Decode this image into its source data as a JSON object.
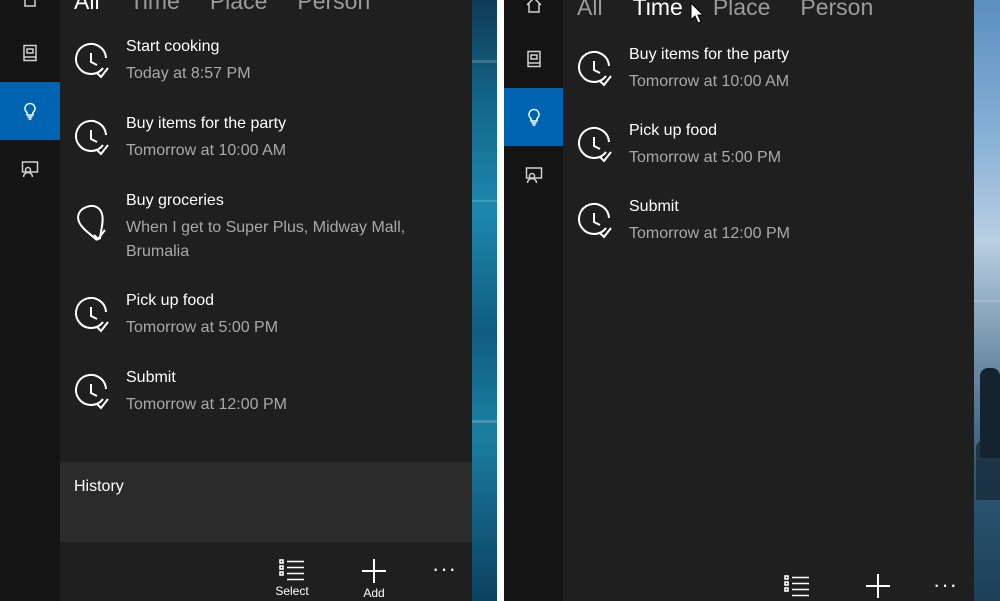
{
  "colors": {
    "accent": "#0063b1",
    "panel": "#1f1f1f",
    "rail": "#141414",
    "history": "#2b2b2b",
    "muted": "#a9a9a9"
  },
  "left_pane": {
    "tabs": [
      {
        "label": "All"
      },
      {
        "label": "Time"
      },
      {
        "label": "Place"
      },
      {
        "label": "Person"
      }
    ],
    "selected_tab": "All",
    "rail_icons": [
      "home-icon",
      "notebook-icon",
      "lightbulb-icon",
      "reminder-person-icon"
    ],
    "tasks": [
      {
        "title": "Start cooking",
        "detail": "Today at 8:57 PM",
        "icon": "clock-check-icon"
      },
      {
        "title": "Buy items for the party",
        "detail": "Tomorrow at 10:00 AM",
        "icon": "clock-check-icon"
      },
      {
        "title": "Buy groceries",
        "detail": "When I get to Super Plus, Midway Mall, Brumalia",
        "icon": "location-pin-icon"
      },
      {
        "title": "Pick up food",
        "detail": "Tomorrow at 5:00 PM",
        "icon": "clock-check-icon"
      },
      {
        "title": "Submit",
        "detail": "Tomorrow at 12:00 PM",
        "icon": "clock-check-icon"
      }
    ],
    "history_label": "History",
    "commands": {
      "select_label": "Select",
      "add_label": "Add",
      "more_label": "···"
    }
  },
  "right_pane": {
    "tabs": [
      {
        "label": "All"
      },
      {
        "label": "Time"
      },
      {
        "label": "Place"
      },
      {
        "label": "Person"
      }
    ],
    "selected_tab": "Time",
    "rail_icons": [
      "home-icon",
      "notebook-icon",
      "lightbulb-icon",
      "reminder-person-icon"
    ],
    "tasks": [
      {
        "title": "Buy items for the party",
        "detail": "Tomorrow at 10:00 AM",
        "icon": "clock-check-icon"
      },
      {
        "title": "Pick up food",
        "detail": "Tomorrow at 5:00 PM",
        "icon": "clock-check-icon"
      },
      {
        "title": "Submit",
        "detail": "Tomorrow at 12:00 PM",
        "icon": "clock-check-icon"
      }
    ],
    "commands": {
      "more_label": "···"
    }
  }
}
